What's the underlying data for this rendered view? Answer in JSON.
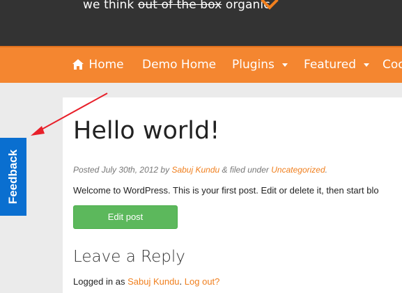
{
  "header": {
    "tagline_before": "we think",
    "tagline_strike": "out of the box",
    "tagline_after": "organic"
  },
  "nav": {
    "items": [
      {
        "label": "Home",
        "icon": "home-icon"
      },
      {
        "label": "Demo Home"
      },
      {
        "label": "Plugins",
        "dropdown": true
      },
      {
        "label": "Featured",
        "dropdown": true
      },
      {
        "label": "Coo"
      }
    ]
  },
  "post": {
    "title": "Hello world!",
    "meta_prefix": "Posted July 30th, 2012 by",
    "author": "Sabuj Kundu",
    "meta_middle": "& filed under",
    "category": "Uncategorized",
    "meta_suffix": ".",
    "body": "Welcome to WordPress. This is your first post. Edit or delete it, then start blo",
    "edit_label": "Edit post"
  },
  "reply": {
    "heading": "Leave a Reply",
    "logged_prefix": "Logged in as",
    "user": "Sabuj Kundu",
    "logged_mid": ".",
    "logout": "Log out?"
  },
  "feedback": {
    "label": "Feedback",
    "color": "#0a6fd0"
  },
  "colors": {
    "accent": "#f48630",
    "link": "#f07f1e",
    "button": "#5cb85c",
    "annotation_arrow": "#e8202a"
  }
}
